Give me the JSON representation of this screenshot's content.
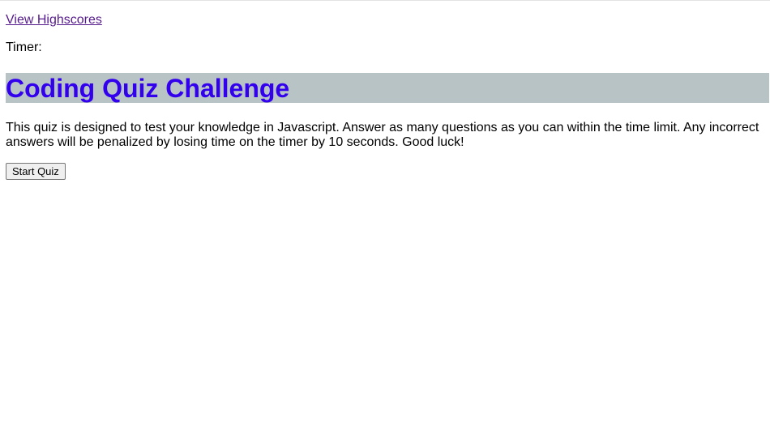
{
  "nav": {
    "highscores_link": "View Highscores"
  },
  "timer": {
    "label": "Timer:"
  },
  "header": {
    "title": "Coding Quiz Challenge",
    "title_color": "#3300ee",
    "bar_color": "#b7c3c4"
  },
  "intro": {
    "description": "This quiz is designed to test your knowledge in Javascript. Answer as many questions as you can within the time limit. Any incorrect answers will be penalized by losing time on the timer by 10 seconds. Good luck!"
  },
  "actions": {
    "start_label": "Start Quiz"
  }
}
